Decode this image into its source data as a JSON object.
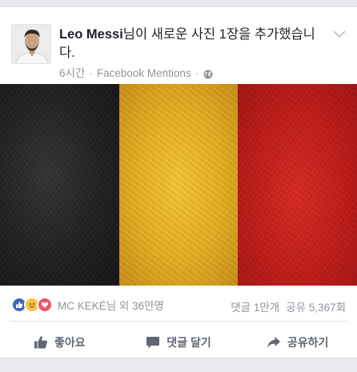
{
  "post": {
    "author": "Leo Messi",
    "action_text": "님이 새로운 사진 1장을 추가했습니다.",
    "time": "6시간",
    "source": "Facebook Mentions",
    "audience_icon": "globe-icon",
    "menu_icon": "chevron-down-icon"
  },
  "photo": {
    "subject": "flag",
    "colors": [
      "#202020",
      "#e2ab22",
      "#bd1c18"
    ]
  },
  "reactions": {
    "icons": [
      "like-icon",
      "sad-icon",
      "love-icon"
    ],
    "summary": "MC KEKÉ님 외 36만명",
    "comments": "댓글 1만개",
    "shares": "공유 5,367회"
  },
  "actions": {
    "like_label": "좋아요",
    "comment_label": "댓글 달기",
    "share_label": "공유하기"
  },
  "colors": {
    "background": "#e9ebee",
    "meta_text": "#90949c",
    "like_blue": "#4267b2"
  }
}
